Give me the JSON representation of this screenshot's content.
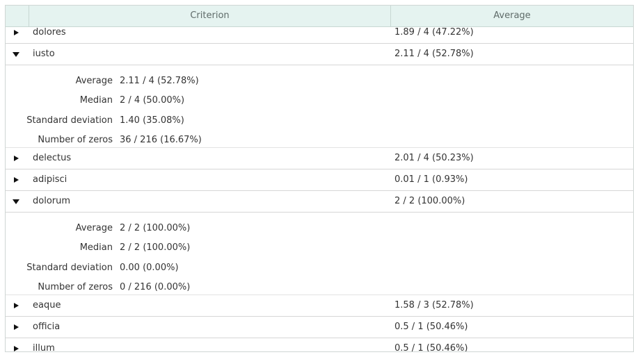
{
  "table": {
    "headers": {
      "criterion": "Criterion",
      "average": "Average"
    },
    "rows": [
      {
        "name": "dolores",
        "average": "1.89 / 4 (47.22%)",
        "expanded": false
      },
      {
        "name": "iusto",
        "average": "2.11 / 4 (52.78%)",
        "expanded": true,
        "details": {
          "average_label": "Average",
          "average": "2.11 / 4 (52.78%)",
          "median_label": "Median",
          "median": "2 / 4 (50.00%)",
          "std_label": "Standard deviation",
          "std": "1.40 (35.08%)",
          "zeros_label": "Number of zeros",
          "zeros": "36 / 216 (16.67%)"
        }
      },
      {
        "name": "delectus",
        "average": "2.01 / 4 (50.23%)",
        "expanded": false
      },
      {
        "name": "adipisci",
        "average": "0.01 / 1 (0.93%)",
        "expanded": false
      },
      {
        "name": "dolorum",
        "average": "2 / 2 (100.00%)",
        "expanded": true,
        "details": {
          "average_label": "Average",
          "average": "2 / 2 (100.00%)",
          "median_label": "Median",
          "median": "2 / 2 (100.00%)",
          "std_label": "Standard deviation",
          "std": "0.00 (0.00%)",
          "zeros_label": "Number of zeros",
          "zeros": "0 / 216 (0.00%)"
        }
      },
      {
        "name": "eaque",
        "average": "1.58 / 3 (52.78%)",
        "expanded": false
      },
      {
        "name": "officia",
        "average": "0.5 / 1 (50.46%)",
        "expanded": false
      },
      {
        "name": "illum",
        "average": "0.5 / 1 (50.46%)",
        "expanded": false
      }
    ]
  },
  "icons": {
    "collapsed": "caret-right-icon",
    "expanded": "caret-down-icon"
  }
}
